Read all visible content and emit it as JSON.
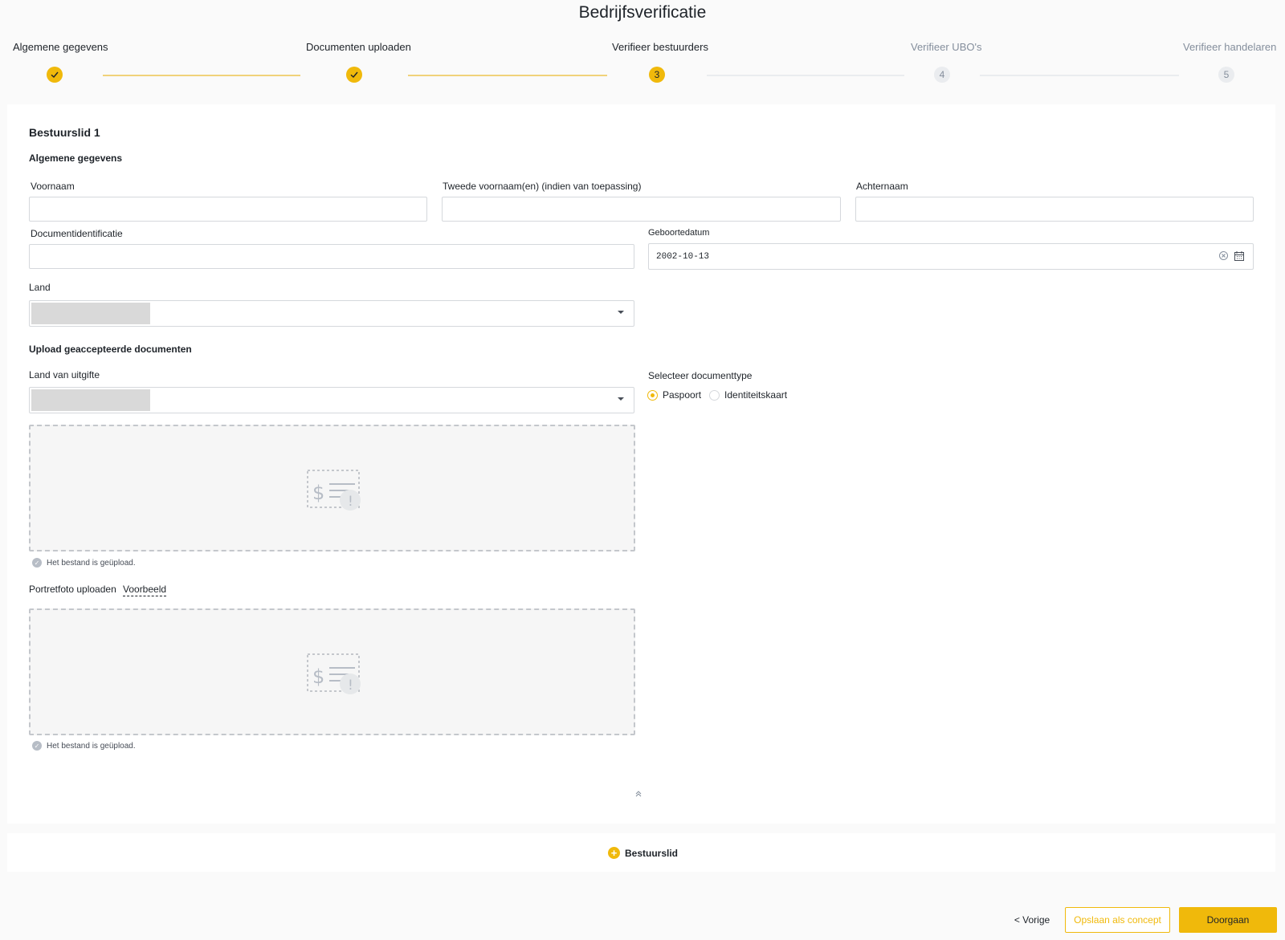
{
  "page": {
    "title": "Bedrijfsverificatie"
  },
  "stepper": {
    "steps": [
      {
        "label": "Algemene gegevens",
        "number": "1",
        "status": "done"
      },
      {
        "label": "Documenten uploaden",
        "number": "2",
        "status": "done"
      },
      {
        "label": "Verifieer bestuurders",
        "number": "3",
        "status": "active"
      },
      {
        "label": "Verifieer UBO's",
        "number": "4",
        "status": "todo"
      },
      {
        "label": "Verifieer handelaren",
        "number": "5",
        "status": "todo"
      }
    ]
  },
  "member": {
    "title": "Bestuurslid 1",
    "general_section": "Algemene gegevens",
    "first_name": {
      "label": "Voornaam",
      "value": ""
    },
    "middle_name": {
      "label": "Tweede voornaam(en) (indien van toepassing)",
      "value": ""
    },
    "last_name": {
      "label": "Achternaam",
      "value": ""
    },
    "document_id": {
      "label": "Documentidentificatie",
      "value": ""
    },
    "birth_date": {
      "label": "Geboortedatum",
      "value": "2002-10-13"
    },
    "country": {
      "label": "Land"
    },
    "upload_section": "Upload geaccepteerde documenten",
    "issue_country": {
      "label": "Land van uitgifte"
    },
    "doc_type": {
      "label": "Selecteer documenttype",
      "options": [
        "Paspoort",
        "Identiteitskaart"
      ],
      "selected": "Paspoort"
    },
    "upload_status": "Het bestand is geüpload.",
    "portrait": {
      "label": "Portretfoto uploaden",
      "example_link": "Voorbeeld"
    },
    "portrait_status": "Het bestand is geüpload."
  },
  "add_member": {
    "label": "Bestuurslid"
  },
  "footer": {
    "prev_label": "< Vorige",
    "draft_label": "Opslaan als concept",
    "next_label": "Doorgaan"
  },
  "colors": {
    "accent": "#f0b90b",
    "muted": "#848e9c",
    "border": "#d5d8dc"
  }
}
